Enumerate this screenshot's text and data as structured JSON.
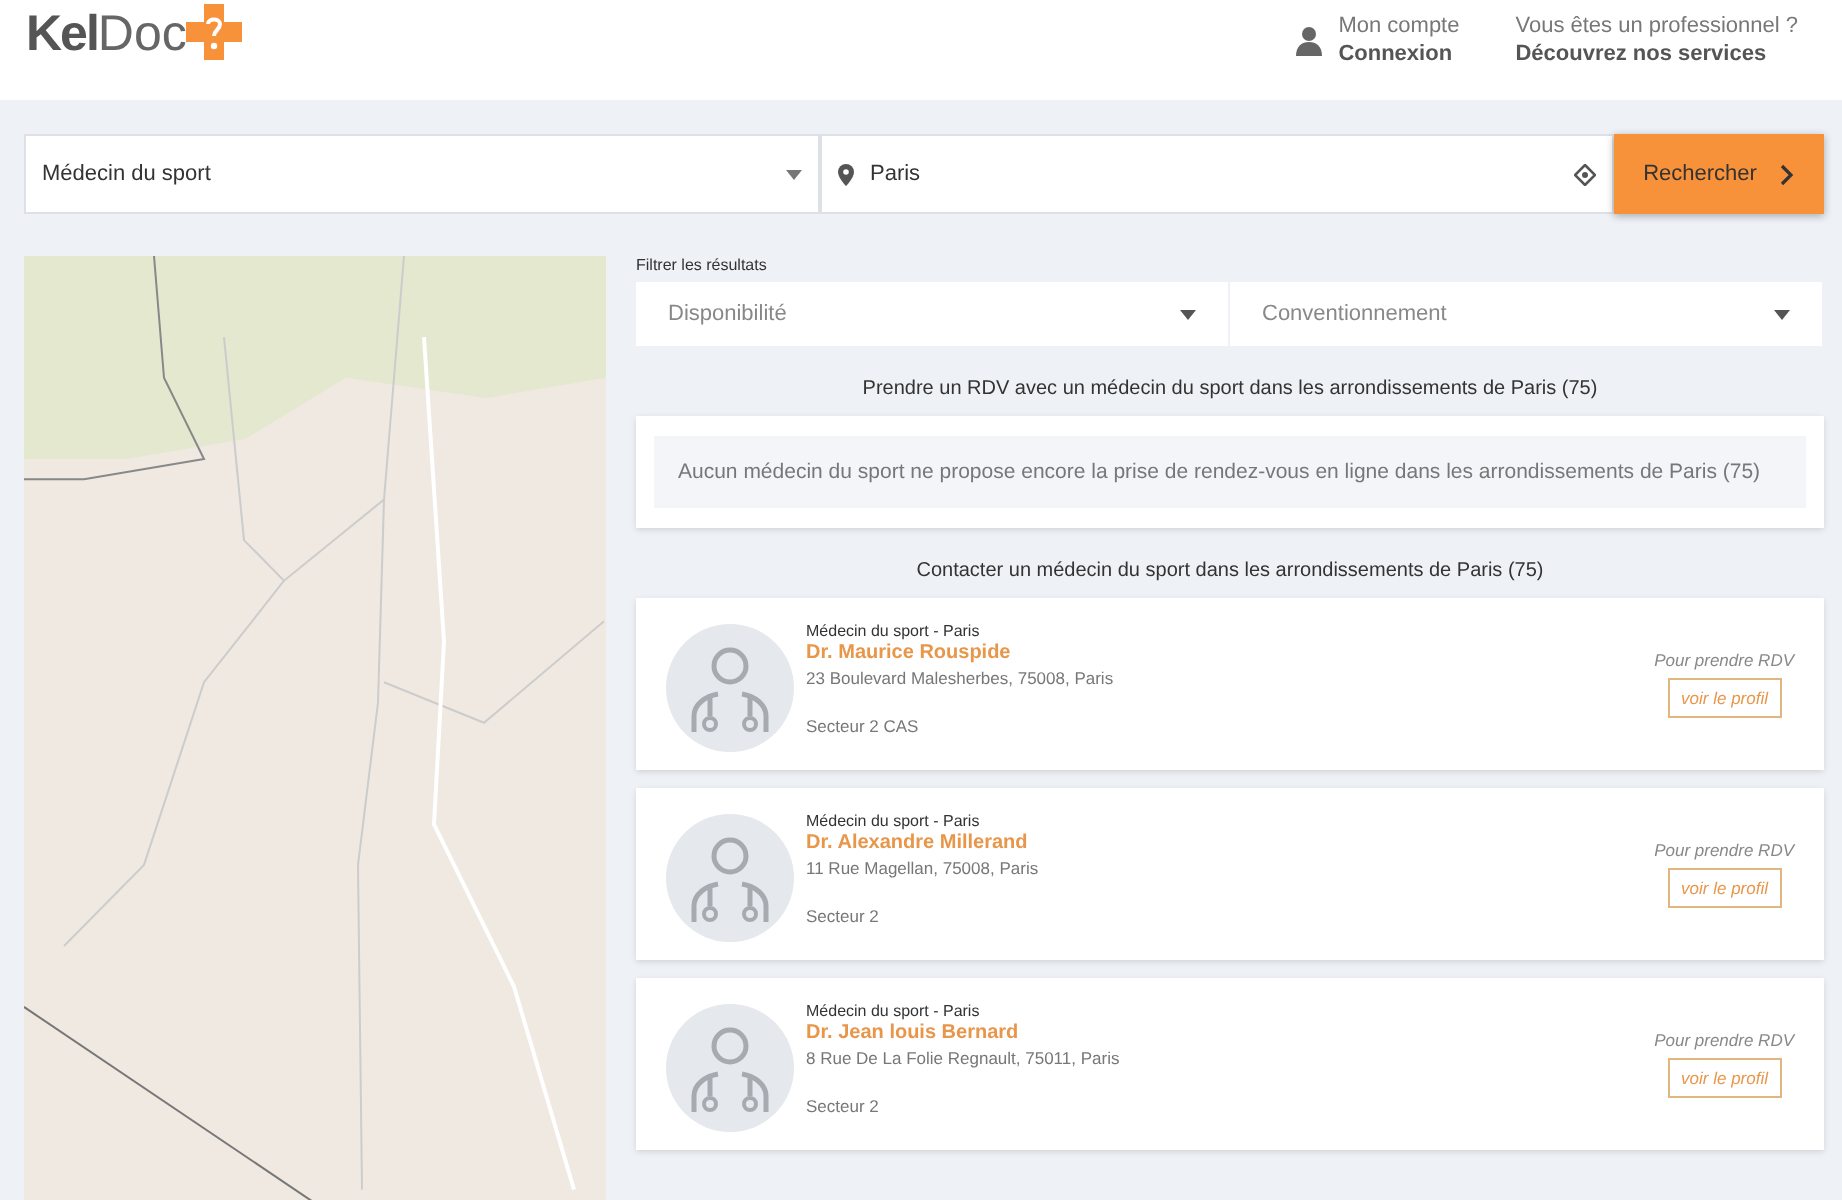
{
  "header": {
    "logo": {
      "text_dark": "Kel",
      "text_light": "Doc"
    },
    "account": {
      "line1": "Mon compte",
      "line2": "Connexion"
    },
    "pro": {
      "line1": "Vous êtes un professionnel ?",
      "line2": "Découvrez nos services"
    }
  },
  "search": {
    "specialty": "Médecin du sport",
    "location": "Paris",
    "button": "Rechercher"
  },
  "filters": {
    "title": "Filtrer les résultats",
    "items": [
      "Disponibilité",
      "Conventionnement"
    ]
  },
  "online_section": {
    "heading": "Prendre un RDV avec un médecin du sport dans les arrondissements de Paris (75)",
    "message": "Aucun médecin du sport ne propose encore la prise de rendez-vous en ligne dans les arrondissements de Paris (75)"
  },
  "contact_section": {
    "heading": "Contacter un médecin du sport dans les arrondissements de Paris (75)"
  },
  "doctors": [
    {
      "specialty": "Médecin du sport - Paris",
      "name": "Dr. Maurice Rouspide",
      "address": "23 Boulevard Malesherbes, 75008, Paris",
      "sector": "Secteur 2 CAS",
      "cta_label": "Pour prendre RDV",
      "cta_button": "voir le profil"
    },
    {
      "specialty": "Médecin du sport - Paris",
      "name": "Dr. Alexandre Millerand",
      "address": "11 Rue Magellan, 75008, Paris",
      "sector": "Secteur 2",
      "cta_label": "Pour prendre RDV",
      "cta_button": "voir le profil"
    },
    {
      "specialty": "Médecin du sport - Paris",
      "name": "Dr. Jean louis Bernard",
      "address": "8 Rue De La Folie Regnault, 75011, Paris",
      "sector": "Secteur 2",
      "cta_label": "Pour prendre RDV",
      "cta_button": "voir le profil"
    }
  ]
}
